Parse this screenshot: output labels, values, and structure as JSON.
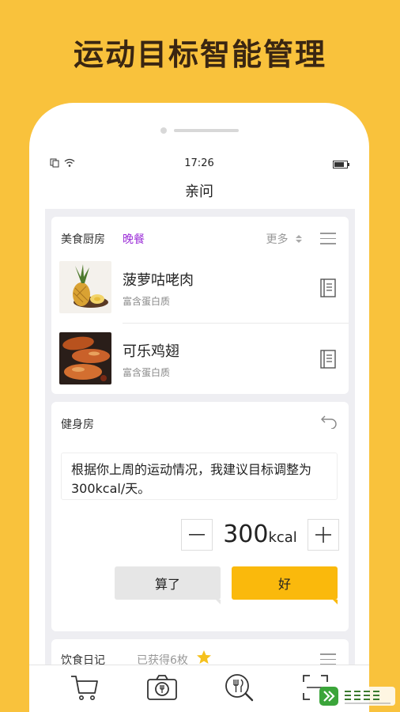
{
  "headline": "运动目标智能管理",
  "status_bar": {
    "time": "17:26"
  },
  "nav": {
    "title": "亲问"
  },
  "kitchen": {
    "title": "美食厨房",
    "meal": "晚餐",
    "more_label": "更多",
    "dishes": [
      {
        "name": "菠萝咕咾肉",
        "subtitle": "富含蛋白质",
        "image": "pineapple-photo"
      },
      {
        "name": "可乐鸡翅",
        "subtitle": "富含蛋白质",
        "image": "chicken-wings-photo"
      }
    ]
  },
  "gym": {
    "title": "健身房",
    "suggestion": "根据你上周的运动情况，我建议目标调整为300kcal/天。",
    "stepper": {
      "value": "300",
      "unit": "kcal"
    },
    "cancel_label": "算了",
    "ok_label": "好"
  },
  "diary": {
    "title": "饮食日记",
    "badge_text": "已获得6枚"
  },
  "tabbar": {
    "items": [
      "cart-icon",
      "camera-icon",
      "food-search-icon",
      "scan-icon"
    ]
  },
  "watermark": {
    "brand": "快盘下载"
  },
  "colors": {
    "background": "#F9C23C",
    "accent": "#FAB90C",
    "meal_tag": "#9C2FD8"
  }
}
